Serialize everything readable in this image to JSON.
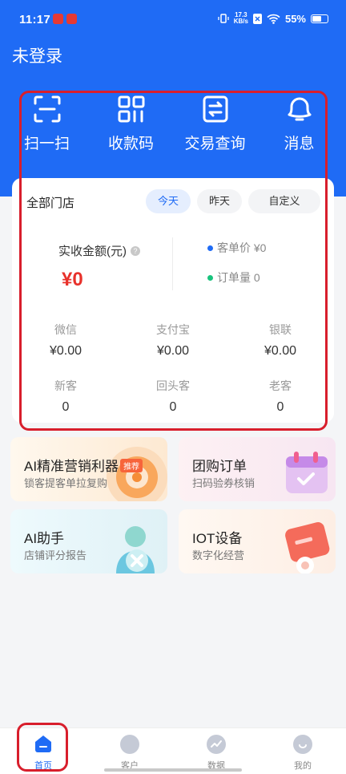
{
  "status_bar": {
    "time": "11:17",
    "network_speed_value": "17.3",
    "network_speed_unit": "KB/s",
    "battery": "55%"
  },
  "header": {
    "login_text": "未登录"
  },
  "quick_actions": [
    {
      "label": "扫一扫",
      "icon": "scan-icon"
    },
    {
      "label": "收款码",
      "icon": "qr-code-icon"
    },
    {
      "label": "交易查询",
      "icon": "transaction-search-icon"
    },
    {
      "label": "消息",
      "icon": "message-bell-icon"
    }
  ],
  "summary": {
    "store_name": "全部门店",
    "filters": [
      "今天",
      "昨天",
      "自定义"
    ],
    "selected_filter": "今天",
    "amount_label": "实收金额(元)",
    "help_mark": "?",
    "amount_value": "¥0",
    "avg_order_label": "客单价 ¥0",
    "order_count_label": "订单量 0",
    "payments": [
      {
        "label": "微信",
        "value": "¥0.00"
      },
      {
        "label": "支付宝",
        "value": "¥0.00"
      },
      {
        "label": "银联",
        "value": "¥0.00"
      }
    ],
    "customers": [
      {
        "label": "新客",
        "value": "0"
      },
      {
        "label": "回头客",
        "value": "0"
      },
      {
        "label": "老客",
        "value": "0"
      }
    ]
  },
  "feature_tiles": [
    {
      "title": "AI精准营销利器",
      "badge": "推荐",
      "subtitle": "锁客提客单拉复购"
    },
    {
      "title": "团购订单",
      "subtitle": "扫码验券核销"
    },
    {
      "title": "AI助手",
      "subtitle": "店铺评分报告"
    },
    {
      "title": "IOT设备",
      "subtitle": "数字化经营"
    }
  ],
  "tab_bar": [
    {
      "label": "首页",
      "icon": "home-icon"
    },
    {
      "label": "客户",
      "icon": "customer-icon"
    },
    {
      "label": "数据",
      "icon": "data-chart-icon"
    },
    {
      "label": "我的",
      "icon": "profile-icon"
    }
  ],
  "colors": {
    "primary": "#1f6bf5",
    "amount_red": "#e8312b",
    "highlight_red": "#d81e2c"
  }
}
